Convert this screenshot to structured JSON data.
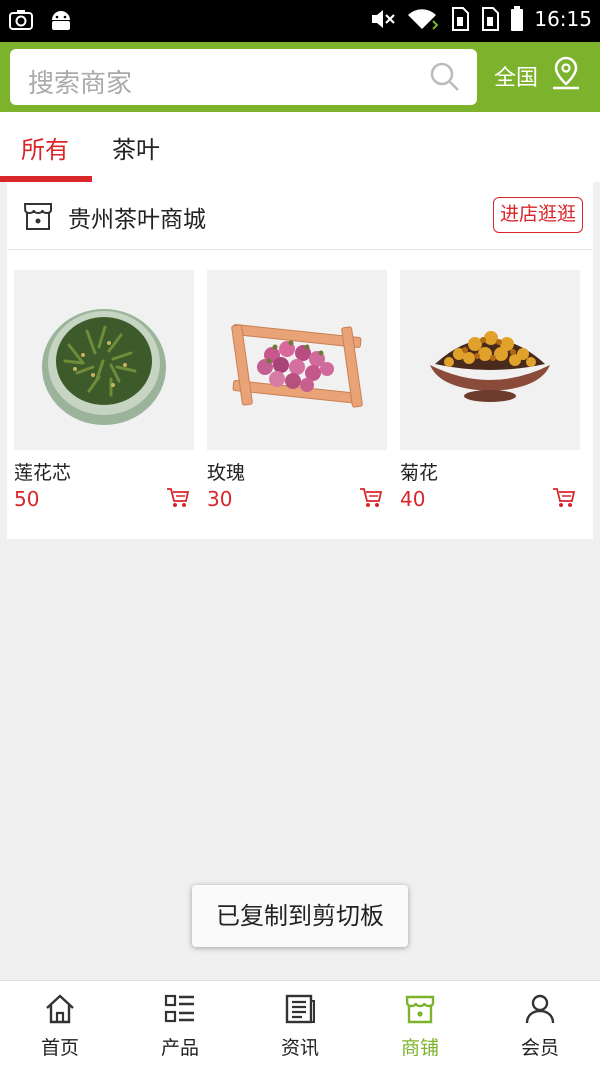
{
  "status_bar": {
    "time": "16:15"
  },
  "search": {
    "placeholder": "搜索商家",
    "region": "全国"
  },
  "tabs": [
    {
      "label": "所有",
      "active": true
    },
    {
      "label": "茶叶",
      "active": false
    }
  ],
  "shop": {
    "name": "贵州茶叶商城",
    "visit_label": "进店逛逛",
    "products": [
      {
        "name": "莲花芯",
        "price": "50"
      },
      {
        "name": "玫瑰",
        "price": "30"
      },
      {
        "name": "菊花",
        "price": "40"
      }
    ]
  },
  "toast": "已复制到剪切板",
  "bottom_nav": [
    {
      "label": "首页",
      "icon": "home-icon"
    },
    {
      "label": "产品",
      "icon": "list-icon"
    },
    {
      "label": "资讯",
      "icon": "news-icon"
    },
    {
      "label": "商铺",
      "icon": "shop-icon",
      "active": true
    },
    {
      "label": "会员",
      "icon": "user-icon"
    }
  ],
  "colors": {
    "brand_green": "#7db32c",
    "accent_red": "#d9262b"
  }
}
